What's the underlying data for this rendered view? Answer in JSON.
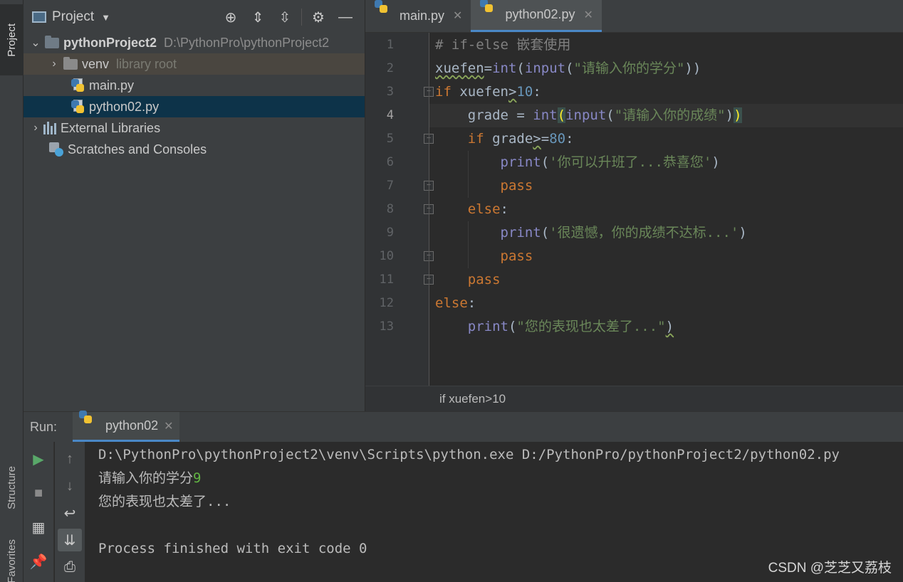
{
  "left_strip": {
    "project": "Project",
    "structure": "Structure",
    "favorites": "Favorites"
  },
  "project_panel": {
    "title": "Project",
    "tree": [
      {
        "label": "pythonProject2",
        "path": "D:\\PythonPro\\pythonProject2"
      },
      {
        "label": "venv",
        "hint": "library root"
      },
      {
        "label": "main.py"
      },
      {
        "label": "python02.py"
      },
      {
        "label": "External Libraries"
      },
      {
        "label": "Scratches and Consoles"
      }
    ]
  },
  "editor": {
    "tabs": [
      {
        "label": "main.py"
      },
      {
        "label": "python02.py"
      }
    ],
    "line_numbers": [
      "1",
      "2",
      "3",
      "4",
      "5",
      "6",
      "7",
      "8",
      "9",
      "10",
      "11",
      "12",
      "13"
    ],
    "breadcrumb": "if xuefen>10"
  },
  "run": {
    "label": "Run:",
    "tab": "python02",
    "console": {
      "command": "D:\\PythonPro\\pythonProject2\\venv\\Scripts\\python.exe D:/PythonPro/pythonProject2/python02.py",
      "prompt": "请输入你的学分",
      "input": "9",
      "output": "您的表现也太差了...",
      "finished": "Process finished with exit code 0"
    }
  },
  "watermark": "CSDN @芝芝又荔枝"
}
